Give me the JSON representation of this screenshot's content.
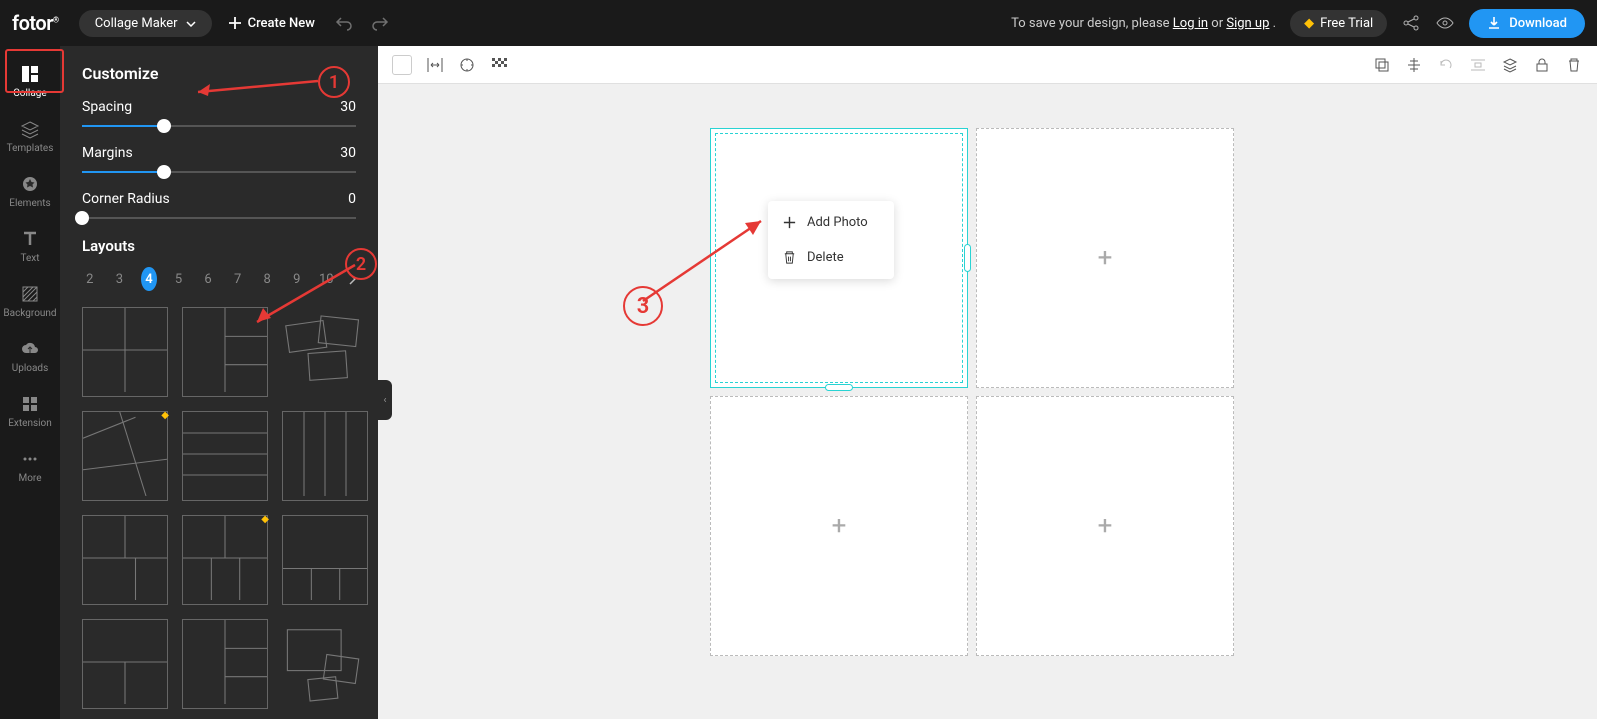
{
  "header": {
    "logo": "fotor",
    "mode_label": "Collage Maker",
    "create_new": "Create New",
    "save_msg_prefix": "To save your design, please ",
    "login": "Log in",
    "or": "  or  ",
    "signup": "Sign up",
    "save_msg_suffix": " .",
    "free_trial": "Free Trial",
    "download": "Download"
  },
  "leftnav": [
    {
      "label": "Collage",
      "icon": "collage"
    },
    {
      "label": "Templates",
      "icon": "layers"
    },
    {
      "label": "Elements",
      "icon": "star"
    },
    {
      "label": "Text",
      "icon": "text"
    },
    {
      "label": "Background",
      "icon": "hatch"
    },
    {
      "label": "Uploads",
      "icon": "cloud"
    },
    {
      "label": "Extension",
      "icon": "ext"
    },
    {
      "label": "More",
      "icon": "dots"
    }
  ],
  "panel": {
    "title": "Customize",
    "spacing_label": "Spacing",
    "spacing_value": "30",
    "margins_label": "Margins",
    "margins_value": "30",
    "corner_label": "Corner Radius",
    "corner_value": "0",
    "layouts_title": "Layouts",
    "tabs": [
      "2",
      "3",
      "4",
      "5",
      "6",
      "7",
      "8",
      "9",
      "10"
    ],
    "active_tab": "4"
  },
  "context_menu": {
    "add_photo": "Add Photo",
    "delete": "Delete"
  },
  "annotations": {
    "one": "1",
    "two": "2",
    "three": "3"
  }
}
